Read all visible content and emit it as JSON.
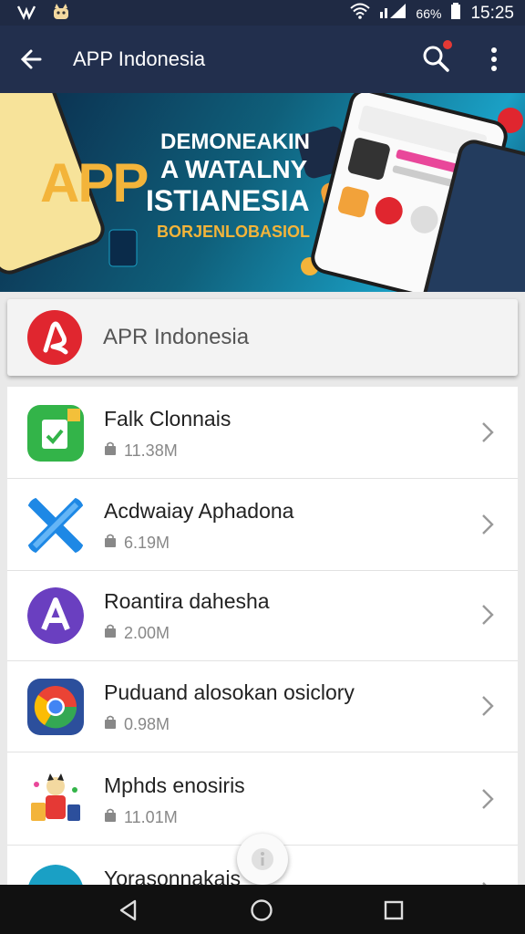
{
  "status_bar": {
    "battery_label": "66%",
    "time": "15:25"
  },
  "app_bar": {
    "title": "APP Indonesia"
  },
  "banner": {
    "word_app": "APP",
    "line1": "DEMONEAKIN",
    "line2": "A WATALNY",
    "line3": "ISTIANESIA",
    "subtitle": "BORJENLOBASIOL"
  },
  "featured": {
    "title": "APR Indonesia"
  },
  "apps": [
    {
      "name": "Falk Clonnais",
      "size": "11.38M"
    },
    {
      "name": "Acdwaiay Aphadona",
      "size": "6.19M"
    },
    {
      "name": "Roantira dahesha",
      "size": "2.00M"
    },
    {
      "name": "Puduand alosokan osiclory",
      "size": "0.98M"
    },
    {
      "name": "Mphds enosiris",
      "size": "11.01M"
    },
    {
      "name": "Yorasonnakais",
      "size": ""
    }
  ],
  "colors": {
    "appbar": "#222f4d",
    "statusbar": "#1f2a44",
    "accent": "#f3b43a",
    "featured_logo": "#e0262f"
  }
}
